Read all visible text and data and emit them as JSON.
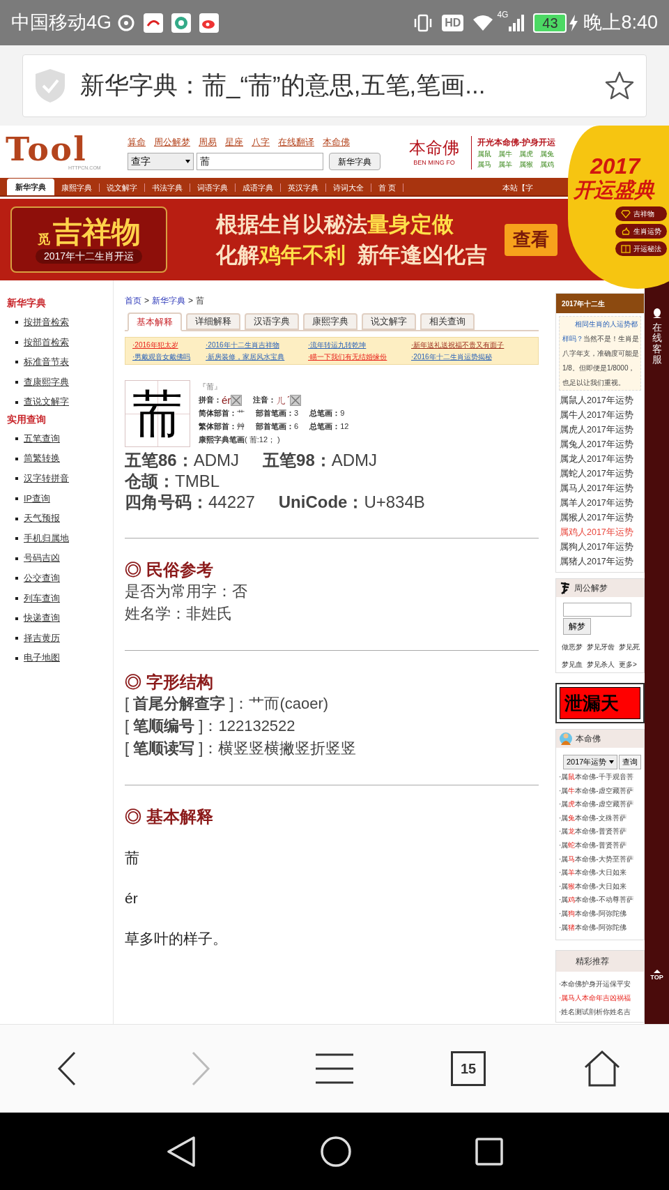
{
  "status_bar": {
    "carrier": "中国移动4G",
    "hd": "HD",
    "network": "4G",
    "battery": "43",
    "time": "晚上8:40"
  },
  "address_bar": {
    "title": "新华字典：荋_“荋”的意思,五笔,笔画..."
  },
  "header": {
    "logo": "Tool",
    "logo_sub": "HTTPCN.COM",
    "links": [
      "算命",
      "周公解梦",
      "周易",
      "星座",
      "八字",
      "在线翻译",
      "本命佛"
    ],
    "search": {
      "select": "查字",
      "value": "荋",
      "button": "新华字典"
    },
    "ad": {
      "logo": "本命佛",
      "logo_sub": "BEN MING FO",
      "title": "开光本命佛-护身开运",
      "zodiacs": [
        "属鼠",
        "属牛",
        "属虎",
        "属兔",
        "属马",
        "属羊",
        "属猴",
        "属鸡"
      ]
    }
  },
  "nav": {
    "tabs": [
      {
        "label": "新华字典",
        "selected": true
      },
      {
        "label": "康熙字典",
        "selected": false
      },
      {
        "label": "说文解字",
        "selected": false
      },
      {
        "label": "书法字典",
        "selected": false
      },
      {
        "label": "词语字典",
        "selected": false
      },
      {
        "label": "成语字典",
        "selected": false
      },
      {
        "label": "英汉字典",
        "selected": false
      },
      {
        "label": "诗词大全",
        "selected": false
      },
      {
        "label": "首 页",
        "selected": false
      }
    ],
    "right": "本站【字"
  },
  "banner": {
    "mascot_tag": "觅",
    "mascot": "吉祥物",
    "mascot_caption": "2017年十二生肖开运",
    "line1": [
      {
        "text": "根据生肖以秘法",
        "highlight": false
      },
      {
        "text": "量身定做",
        "highlight": true
      }
    ],
    "line2": [
      {
        "text": "化解",
        "highlight": false
      },
      {
        "text": "鸡年不利",
        "highlight": true
      },
      {
        "text": "  新年逢凶化吉",
        "highlight": false
      }
    ],
    "button": "查看"
  },
  "promo_circle": {
    "year": "2017",
    "title": "开运盛典",
    "items": [
      "吉祥物",
      "生肖运势",
      "开运秘法"
    ]
  },
  "sidebar": [
    {
      "title": "新华字典",
      "items": [
        "按拼音检索",
        "按部首检索",
        "标准音节表",
        "查康熙字典",
        "查说文解字"
      ]
    },
    {
      "title": "实用查询",
      "items": [
        "五笔查询",
        "简繁转换",
        "汉字转拼音",
        "IP查询",
        "天气预报",
        "手机归属地",
        "号码吉凶",
        "公交查询",
        "列车查询",
        "快递查询",
        "择吉黄历",
        "电子地图"
      ]
    }
  ],
  "main": {
    "breadcrumb": [
      "首页",
      "新华字典",
      "荋"
    ],
    "breadcrumb_sep": ">",
    "tabs": [
      {
        "label": "基本解释",
        "selected": true
      },
      {
        "label": "详细解释",
        "selected": false
      },
      {
        "label": "汉语字典",
        "selected": false
      },
      {
        "label": "康熙字典",
        "selected": false
      },
      {
        "label": "说文解字",
        "selected": false
      },
      {
        "label": "相关查询",
        "selected": false
      }
    ],
    "promo_links": [
      {
        "text": "·2016年犯太岁",
        "color": "#e8221b"
      },
      {
        "text": "·2016年十二生肖吉祥物",
        "color": "#2a62b8"
      },
      {
        "text": "·流年转运九转乾坤",
        "color": "#2a62b8"
      },
      {
        "text": "·新年送礼送祝福不贵又有面子",
        "color": "#9a2a1a"
      },
      {
        "text": "·男戴观音女戴佛吗",
        "color": "#2a62b8"
      },
      {
        "text": "·新房装修，家居风水宝典",
        "color": "#2a62b8"
      },
      {
        "text": "·瞄一下我们有无结婚缘份",
        "color": "#e8221b"
      },
      {
        "text": "·2016年十二生肖运势揭秘",
        "color": "#2a62b8"
      }
    ],
    "character": "荋",
    "character_quoted": "『荋』",
    "info_rows": [
      [
        {
          "label": "拼音：",
          "value": "ér",
          "kind": "sound"
        },
        {
          "label": "注音：",
          "value": "ㄦˊ",
          "kind": "sound"
        }
      ],
      [
        {
          "label": "简体部首：",
          "value": "艹",
          "kind": "plain"
        },
        {
          "label": "部首笔画：",
          "value": "3",
          "kind": "plain"
        },
        {
          "label": "总笔画：",
          "value": "9",
          "kind": "plain"
        }
      ],
      [
        {
          "label": "繁体部首：",
          "value": "艸",
          "kind": "plain"
        },
        {
          "label": "部首笔画：",
          "value": "6",
          "kind": "plain"
        },
        {
          "label": "总笔画：",
          "value": "12",
          "kind": "plain"
        }
      ],
      [
        {
          "label": "康熙字典笔画",
          "value": "( 荋:12； )",
          "kind": "plain"
        }
      ]
    ],
    "codes": [
      [
        {
          "label": "五笔86：",
          "value": "ADMJ"
        },
        {
          "label": "五笔98：",
          "value": "ADMJ"
        },
        {
          "label": "仓颉：",
          "value": "TMBL"
        }
      ],
      [
        {
          "label": "四角号码：",
          "value": "44227"
        },
        {
          "label": "UniCode：",
          "value": "U+834B"
        }
      ]
    ],
    "sections": [
      {
        "title": "◎ 民俗参考",
        "kind": "lines",
        "lines": [
          "是否为常用字：否",
          "姓名学：非姓氏"
        ]
      },
      {
        "title": "◎ 字形结构",
        "kind": "lines",
        "lines": [
          "[ **首尾分解查字** ]：艹而(caoer)",
          "[ **笔顺编号** ]：122132522",
          "[ **笔顺读写** ]：横竖竖横撇竖折竖竖"
        ]
      },
      {
        "title": "◎ 基本解释",
        "kind": "paragraphs",
        "lines": [
          "荋",
          "ér",
          "草多叶的样子。"
        ]
      }
    ]
  },
  "right_column": {
    "fortune": {
      "title": "2017年十二生",
      "note": [
        {
          "link": "相同生肖的人运势都"
        },
        {
          "link": "样吗？",
          "text": "当然不是！生肖是"
        },
        {
          "text": "八字年支，准确度可能是"
        },
        {
          "text": "1/8。但即便是1/8000，"
        },
        {
          "text": "也足以让我们重视。"
        }
      ],
      "items": [
        {
          "text": "属鼠人2017年运势",
          "selected": false
        },
        {
          "text": "属牛人2017年运势",
          "selected": false
        },
        {
          "text": "属虎人2017年运势",
          "selected": false
        },
        {
          "text": "属兔人2017年运势",
          "selected": false
        },
        {
          "text": "属龙人2017年运势",
          "selected": false
        },
        {
          "text": "属蛇人2017年运势",
          "selected": false
        },
        {
          "text": "属马人2017年运势",
          "selected": false
        },
        {
          "text": "属羊人2017年运势",
          "selected": false
        },
        {
          "text": "属猴人2017年运势",
          "selected": false
        },
        {
          "text": "属鸡人2017年运势",
          "selected": true
        },
        {
          "text": "属狗人2017年运势",
          "selected": false
        },
        {
          "text": "属猪人2017年运势",
          "selected": false
        }
      ]
    },
    "dream": {
      "title": "周公解梦",
      "button": "解梦",
      "links": [
        [
          "做恶梦",
          "梦见牙齿",
          "梦见死"
        ],
        [
          "梦见血",
          "梦见杀人",
          "更多>"
        ]
      ]
    },
    "secret_banner": "泄漏天",
    "buddha": {
      "title": "本命佛",
      "select": "2017年运势",
      "button": "查询",
      "items": [
        {
          "prefix": "·属",
          "animal": "鼠",
          "text": "本命佛-千手观音菩"
        },
        {
          "prefix": "·属",
          "animal": "牛",
          "text": "本命佛-虚空藏菩萨"
        },
        {
          "prefix": "·属",
          "animal": "虎",
          "text": "本命佛-虚空藏菩萨"
        },
        {
          "prefix": "·属",
          "animal": "兔",
          "text": "本命佛-文殊菩萨"
        },
        {
          "prefix": "·属",
          "animal": "龙",
          "text": "本命佛-普贤菩萨"
        },
        {
          "prefix": "·属",
          "animal": "蛇",
          "text": "本命佛-普贤菩萨"
        },
        {
          "prefix": "·属",
          "animal": "马",
          "text": "本命佛-大势至菩萨"
        },
        {
          "prefix": "·属",
          "animal": "羊",
          "text": "本命佛-大日如来"
        },
        {
          "prefix": "·属",
          "animal": "猴",
          "text": "本命佛-大日如来"
        },
        {
          "prefix": "·属",
          "animal": "鸡",
          "text": "本命佛-不动尊菩萨"
        },
        {
          "prefix": "·属",
          "animal": "狗",
          "text": "本命佛-阿弥陀佛"
        },
        {
          "prefix": "·属",
          "animal": "猪",
          "text": "本命佛-阿弥陀佛"
        }
      ]
    },
    "picks": {
      "title": "精彩推荐",
      "items": [
        {
          "text": "·本命佛护身开运保平安",
          "hot": false
        },
        {
          "text": "·属马人本命年吉凶祸福",
          "hot": true
        },
        {
          "text": "·姓名测试剖析你姓名吉",
          "hot": false
        }
      ]
    }
  },
  "side_bar": {
    "service": "在线客服",
    "top": "TOP"
  },
  "bottom_nav": [
    {
      "kind": "back",
      "disabled": false
    },
    {
      "kind": "forward",
      "disabled": true
    },
    {
      "kind": "menu",
      "disabled": false
    },
    {
      "kind": "tabs",
      "label": "15",
      "disabled": false
    },
    {
      "kind": "home",
      "disabled": false
    }
  ]
}
